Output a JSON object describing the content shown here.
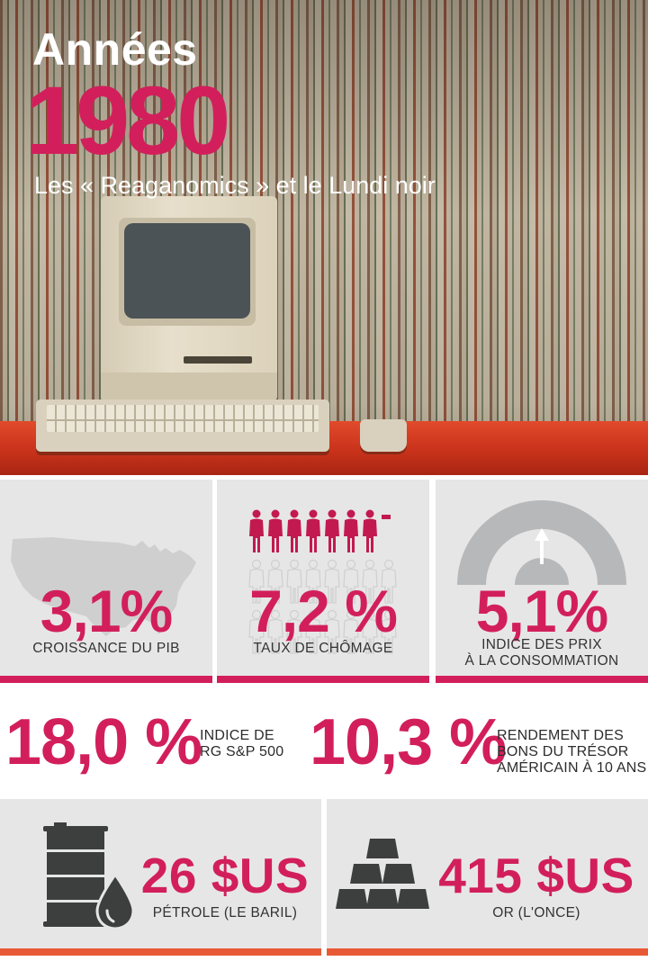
{
  "hero": {
    "word": "Années",
    "year": "1980",
    "subtitle": "Les « Reaganomics » et le Lundi noir"
  },
  "stats": {
    "gdp": {
      "value": "3,1%",
      "label": "CROISSANCE DU PIB",
      "icon": "usa-map-icon"
    },
    "unemployment": {
      "value": "7,2 %",
      "label": "TAUX DE CHÔMAGE",
      "icon": "people-icon",
      "filled_fraction": 0.072
    },
    "cpi": {
      "value": "5,1%",
      "label_line1": "INDICE DES PRIX",
      "label_line2": "À LA CONSOMMATION",
      "icon": "gauge-icon"
    },
    "sp500": {
      "value": "18,0 %",
      "label_line1": "INDICE DE",
      "label_line2": "RG S&P 500"
    },
    "treasury": {
      "value": "10,3 %",
      "label_line1": "RENDEMENT DES",
      "label_line2": "BONS DU TRÉSOR",
      "label_line3": "AMÉRICAIN À 10 ANS"
    },
    "oil": {
      "value": "26 $US",
      "label": "PÉTROLE (LE BARIL)",
      "icon": "oil-barrel-icon"
    },
    "gold": {
      "value": "415 $US",
      "label": "OR (L'ONCE)",
      "icon": "gold-bars-icon"
    }
  },
  "colors": {
    "accent": "#d21f5c",
    "bottom_bar": "#e85a35",
    "tile_bg": "#e7e6e6",
    "icon_dark": "#3d3f3f"
  }
}
